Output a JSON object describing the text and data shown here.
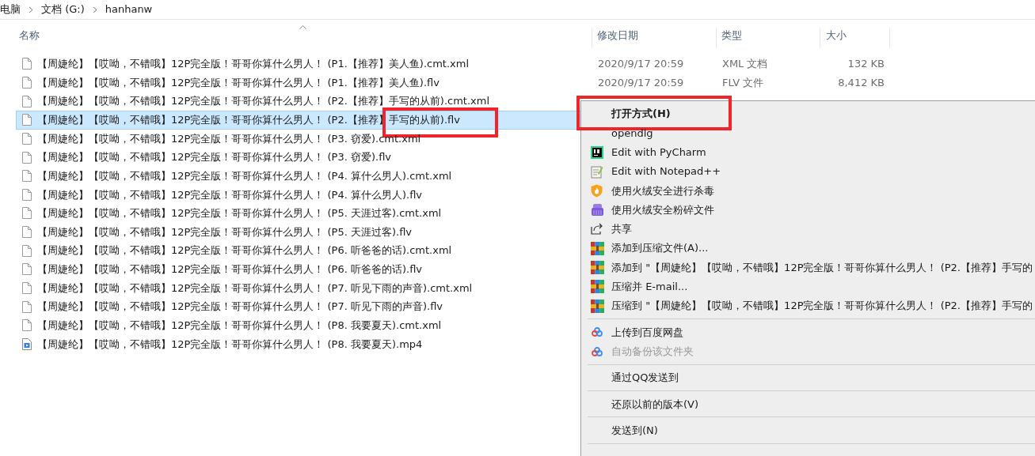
{
  "breadcrumb": [
    "电脑",
    "文档 (G:)",
    "hanhanw"
  ],
  "columns": [
    "名称",
    "修改日期",
    "类型",
    "大小"
  ],
  "files": [
    {
      "kind": "file",
      "name": "【周婕纶】【哎呦，不错哦】12P完全版！哥哥你算什么男人！ (P1.【推荐】美人鱼).cmt.xml",
      "date": "2020/9/17 20:59",
      "type": "XML 文档",
      "size": "132 KB",
      "selected": false,
      "highlighted": false
    },
    {
      "kind": "file",
      "name": "【周婕纶】【哎呦，不错哦】12P完全版！哥哥你算什么男人！ (P1.【推荐】美人鱼).flv",
      "date": "2020/9/17 20:59",
      "type": "FLV 文件",
      "size": "8,412 KB",
      "selected": false,
      "highlighted": false
    },
    {
      "kind": "file",
      "name": "【周婕纶】【哎呦，不错哦】12P完全版！哥哥你算什么男人！ (P2.【推荐】手写的从前).cmt.xml",
      "selected": false,
      "highlighted": false
    },
    {
      "kind": "file",
      "name": "【周婕纶】【哎呦，不错哦】12P完全版！哥哥你算什么男人！ (P2.【推荐】手写的从前).flv",
      "selected": true,
      "highlighted": true
    },
    {
      "kind": "file",
      "name": "【周婕纶】【哎呦，不错哦】12P完全版！哥哥你算什么男人！ (P3. 窃爱).cmt.xml",
      "selected": false,
      "highlighted": false
    },
    {
      "kind": "file",
      "name": "【周婕纶】【哎呦，不错哦】12P完全版！哥哥你算什么男人！ (P3. 窃爱).flv",
      "selected": false,
      "highlighted": false
    },
    {
      "kind": "file",
      "name": "【周婕纶】【哎呦，不错哦】12P完全版！哥哥你算什么男人！ (P4. 算什么男人).cmt.xml",
      "selected": false,
      "highlighted": false
    },
    {
      "kind": "file",
      "name": "【周婕纶】【哎呦，不错哦】12P完全版！哥哥你算什么男人！ (P4. 算什么男人).flv",
      "selected": false,
      "highlighted": false
    },
    {
      "kind": "file",
      "name": "【周婕纶】【哎呦，不错哦】12P完全版！哥哥你算什么男人！ (P5. 天涯过客).cmt.xml",
      "selected": false,
      "highlighted": false
    },
    {
      "kind": "file",
      "name": "【周婕纶】【哎呦，不错哦】12P完全版！哥哥你算什么男人！ (P5. 天涯过客).flv",
      "selected": false,
      "highlighted": false
    },
    {
      "kind": "file",
      "name": "【周婕纶】【哎呦，不错哦】12P完全版！哥哥你算什么男人！ (P6. 听爸爸的话).cmt.xml",
      "selected": false,
      "highlighted": false
    },
    {
      "kind": "file",
      "name": "【周婕纶】【哎呦，不错哦】12P完全版！哥哥你算什么男人！ (P6. 听爸爸的话).flv",
      "selected": false,
      "highlighted": false
    },
    {
      "kind": "file",
      "name": "【周婕纶】【哎呦，不错哦】12P完全版！哥哥你算什么男人！ (P7. 听见下雨的声音).cmt.xml",
      "selected": false,
      "highlighted": false
    },
    {
      "kind": "file",
      "name": "【周婕纶】【哎呦，不错哦】12P完全版！哥哥你算什么男人！ (P7. 听见下雨的声音).flv",
      "selected": false,
      "highlighted": false
    },
    {
      "kind": "file",
      "name": "【周婕纶】【哎呦，不错哦】12P完全版！哥哥你算什么男人！ (P8. 我要夏天).cmt.xml",
      "selected": false,
      "highlighted": false
    },
    {
      "kind": "video",
      "name": "【周婕纶】【哎呦，不错哦】12P完全版！哥哥你算什么男人！ (P8. 我要夏天).mp4",
      "selected": false,
      "highlighted": false
    }
  ],
  "context_menu": [
    {
      "kind": "item",
      "label": "打开方式(H)",
      "bold": true,
      "highlighted": true,
      "disabled": false
    },
    {
      "kind": "item",
      "label": "opendlg",
      "bold": false,
      "highlighted": false,
      "disabled": false
    },
    {
      "kind": "item",
      "label": "Edit with PyCharm",
      "bold": false,
      "highlighted": false,
      "disabled": false
    },
    {
      "kind": "item",
      "label": "Edit with Notepad++",
      "bold": false,
      "highlighted": false,
      "disabled": false
    },
    {
      "kind": "item",
      "label": "使用火绒安全进行杀毒",
      "bold": false,
      "highlighted": false,
      "disabled": false
    },
    {
      "kind": "item",
      "label": "使用火绒安全粉碎文件",
      "bold": false,
      "highlighted": false,
      "disabled": false
    },
    {
      "kind": "item",
      "label": "共享",
      "bold": false,
      "highlighted": false,
      "disabled": false
    },
    {
      "kind": "item",
      "label": "添加到压缩文件(A)...",
      "bold": false,
      "highlighted": false,
      "disabled": false
    },
    {
      "kind": "item",
      "label": "添加到 \"【周婕纶】【哎呦，不错哦】12P完全版！哥哥你算什么男人！ (P2.【推荐】手写的",
      "bold": false,
      "highlighted": false,
      "disabled": false
    },
    {
      "kind": "item",
      "label": "压缩并 E-mail...",
      "bold": false,
      "highlighted": false,
      "disabled": false
    },
    {
      "kind": "item",
      "label": "压缩到 \"【周婕纶】【哎呦，不错哦】12P完全版！哥哥你算什么男人！ (P2.【推荐】手写的",
      "bold": false,
      "highlighted": false,
      "disabled": false
    },
    {
      "kind": "separator"
    },
    {
      "kind": "item",
      "label": "上传到百度网盘",
      "bold": false,
      "highlighted": false,
      "disabled": false
    },
    {
      "kind": "item",
      "label": "自动备份该文件夹",
      "bold": false,
      "highlighted": false,
      "disabled": true
    },
    {
      "kind": "separator"
    },
    {
      "kind": "item",
      "label": "通过QQ发送到",
      "bold": false,
      "highlighted": false,
      "disabled": false
    },
    {
      "kind": "separator"
    },
    {
      "kind": "item",
      "label": "还原以前的版本(V)",
      "bold": false,
      "highlighted": false,
      "disabled": false
    },
    {
      "kind": "separator"
    },
    {
      "kind": "item",
      "label": "发送到(N)",
      "bold": false,
      "highlighted": false,
      "disabled": false
    },
    {
      "kind": "separator"
    }
  ]
}
